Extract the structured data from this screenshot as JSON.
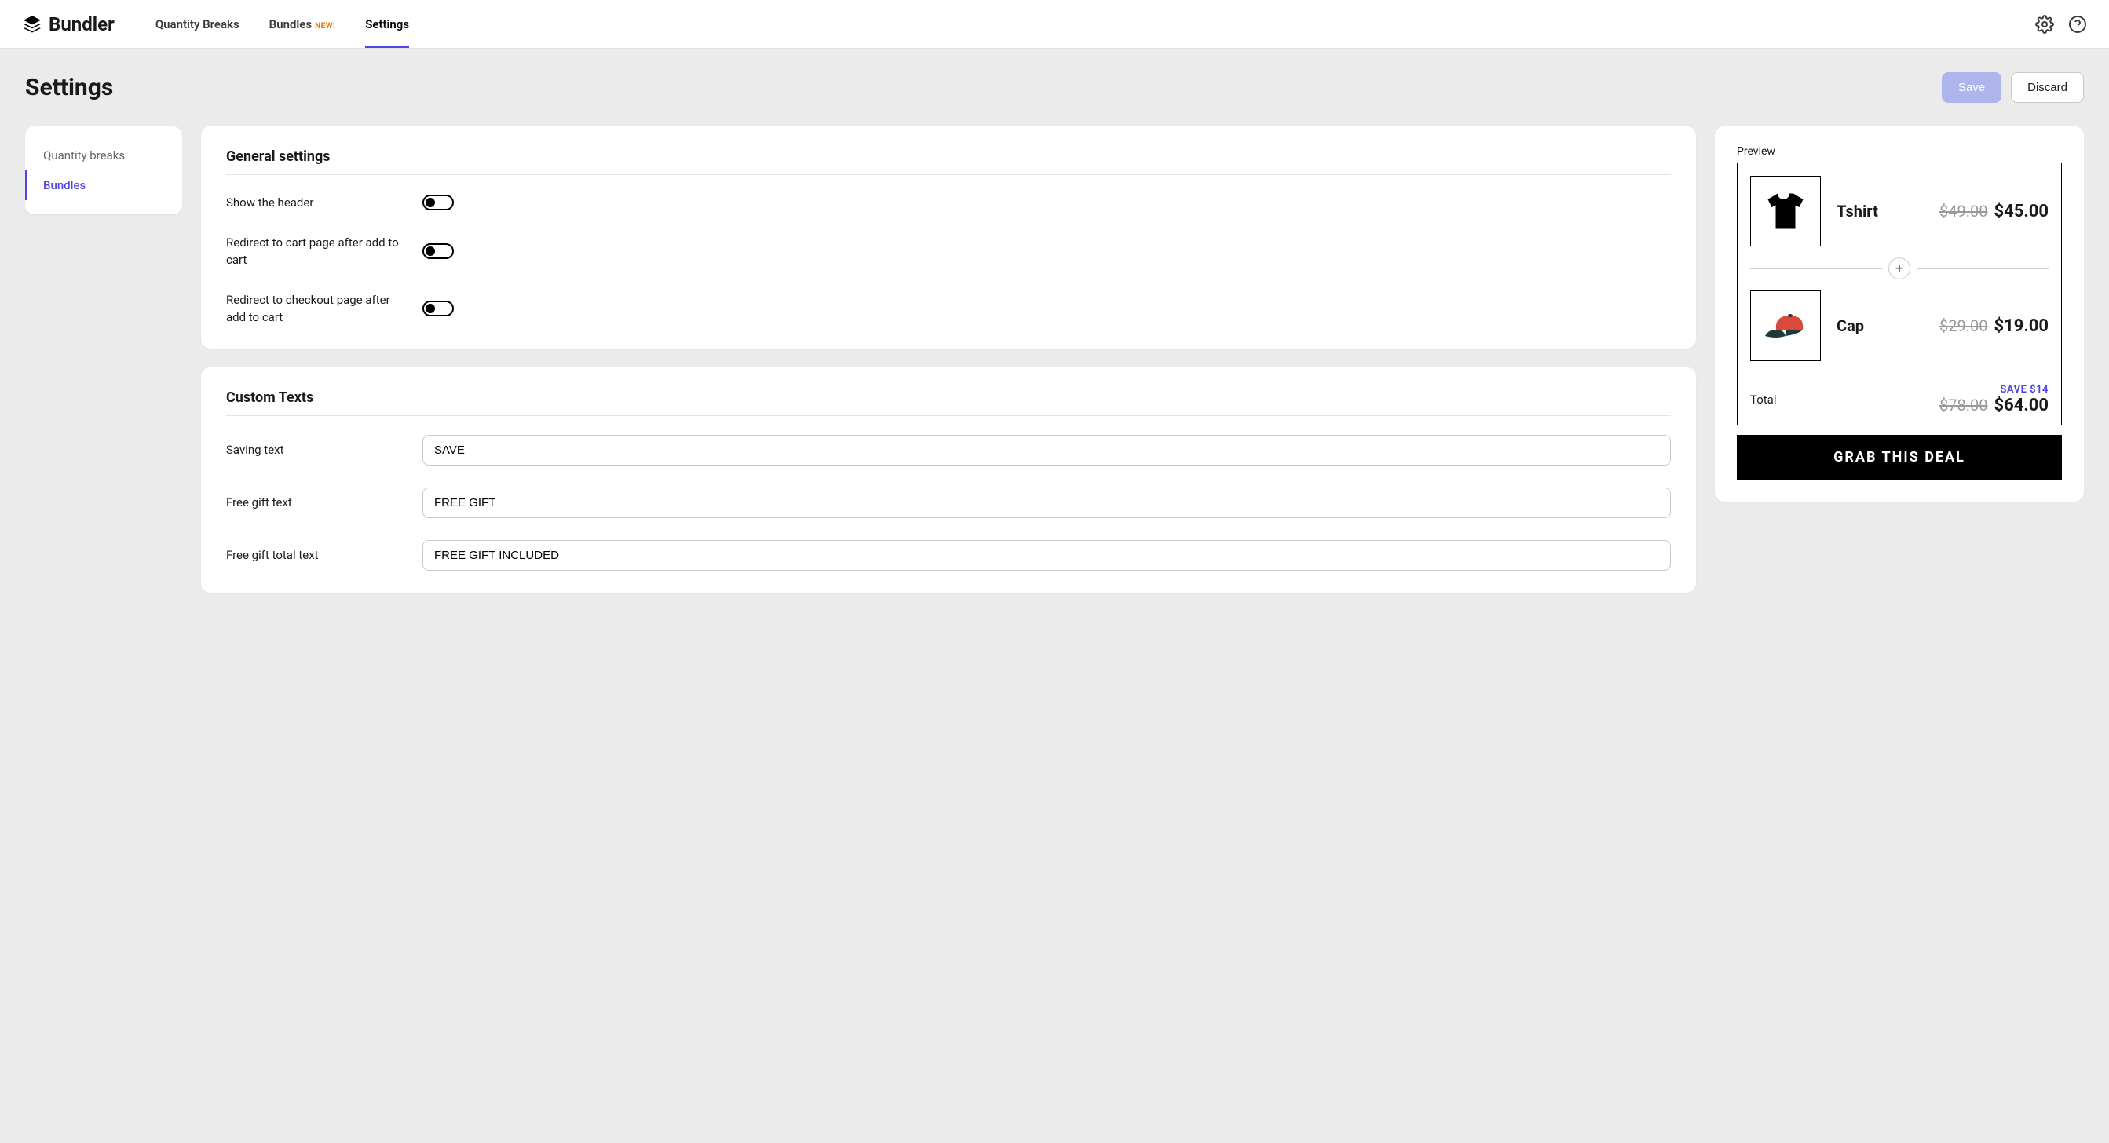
{
  "app": {
    "name": "Bundler"
  },
  "nav": {
    "items": [
      {
        "label": "Quantity Breaks"
      },
      {
        "label": "Bundles",
        "badge": "NEW!"
      },
      {
        "label": "Settings"
      }
    ]
  },
  "page": {
    "title": "Settings",
    "save_label": "Save",
    "discard_label": "Discard"
  },
  "sidebar": {
    "items": [
      {
        "label": "Quantity breaks"
      },
      {
        "label": "Bundles"
      }
    ]
  },
  "general": {
    "title": "General settings",
    "rows": [
      {
        "label": "Show the header",
        "value": false
      },
      {
        "label": "Redirect to cart page after add to cart",
        "value": false
      },
      {
        "label": "Redirect to checkout page after add to cart",
        "value": false
      }
    ]
  },
  "custom": {
    "title": "Custom Texts",
    "rows": [
      {
        "label": "Saving text",
        "value": "SAVE"
      },
      {
        "label": "Free gift text",
        "value": "FREE GIFT"
      },
      {
        "label": "Free gift total text",
        "value": "FREE GIFT INCLUDED"
      }
    ]
  },
  "preview": {
    "label": "Preview",
    "items": [
      {
        "name": "Tshirt",
        "old": "$49.00",
        "new": "$45.00",
        "icon": "tshirt"
      },
      {
        "name": "Cap",
        "old": "$29.00",
        "new": "$19.00",
        "icon": "cap"
      }
    ],
    "total_label": "Total",
    "save_text": "SAVE $14",
    "total_old": "$78.00",
    "total_new": "$64.00",
    "cta": "GRAB THIS DEAL"
  }
}
